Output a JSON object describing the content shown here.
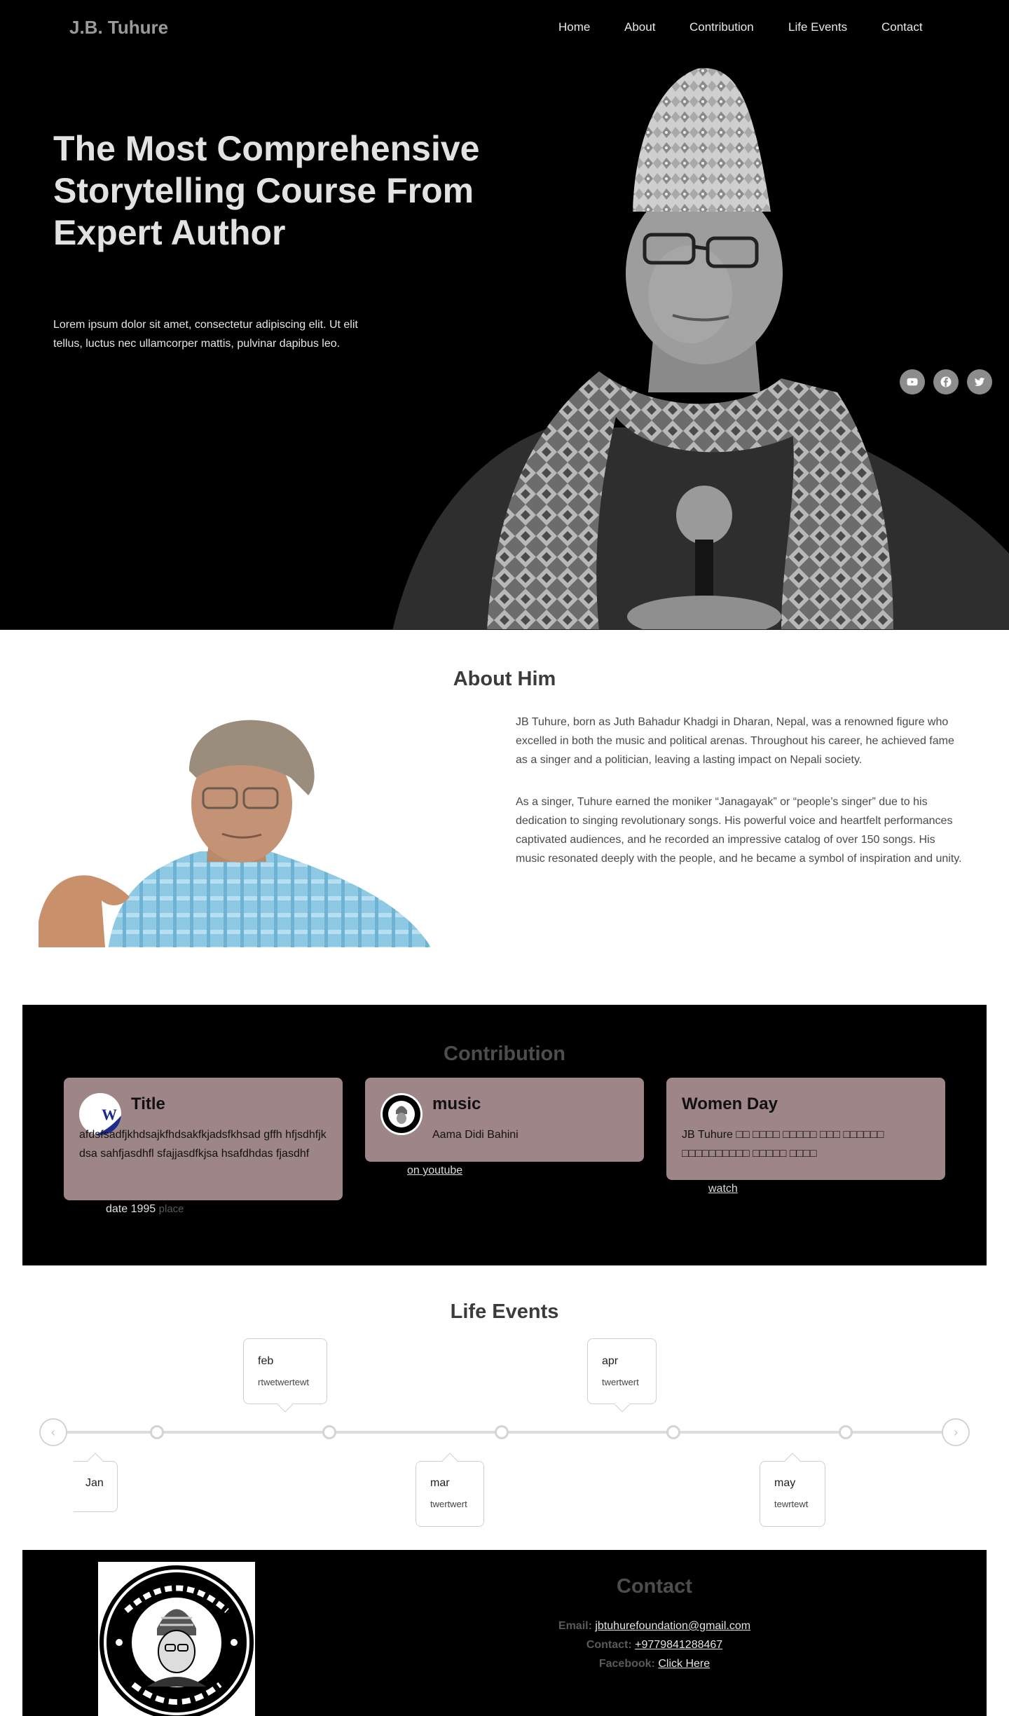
{
  "brand": "J.B. Tuhure",
  "nav": {
    "home": "Home",
    "about": "About",
    "contribution": "Contribution",
    "life_events": "Life Events",
    "contact": "Contact"
  },
  "hero": {
    "title": "The Most Comprehensive Storytelling Course From Expert Author",
    "subtitle": "Lorem ipsum dolor sit amet, consectetur adipiscing elit. Ut elit tellus, luctus nec ullamcorper mattis, pulvinar dapibus leo.",
    "social": [
      "youtube-icon",
      "facebook-icon",
      "twitter-icon"
    ]
  },
  "about": {
    "title": "About Him",
    "p1": "JB Tuhure, born as Juth Bahadur Khadgi in Dharan, Nepal, was a renowned figure who excelled in both the music and political arenas. Throughout his career, he achieved fame as a singer and a politician, leaving a lasting impact on Nepali society.",
    "p2": "As a singer, Tuhure earned the moniker “Janagayak” or “people’s singer” due to his dedication to singing revolutionary songs. His powerful voice and heartfelt performances captivated audiences, and he recorded an impressive catalog of over 150 songs. His music resonated deeply with the people, and he became a symbol of inspiration and unity."
  },
  "contribution": {
    "title": "Contribution",
    "cards": [
      {
        "title": "Title",
        "text": "afdsfsadfjkhdsajkfhdsakfkjadsfkhsad gffh hfjsdhfjkdsa sahfjasdhfl sfajjasdfkjsa hsafdhdas fjasdhf",
        "date": "date 1995",
        "place": "place"
      },
      {
        "title": "music",
        "text": "Aama Didi Bahini",
        "link": "on youtube"
      },
      {
        "title": "Women Day",
        "text": "JB Tuhure □□ □□□□ □□□□□ □□□ □□□□□□ □□□□□□□□□□ □□□□□ □□□□",
        "link": "watch"
      }
    ]
  },
  "life_events": {
    "title": "Life Events",
    "events": [
      {
        "month": "Jan",
        "text": ""
      },
      {
        "month": "feb",
        "text": "rtwetwertewt"
      },
      {
        "month": "mar",
        "text": "twertwert"
      },
      {
        "month": "apr",
        "text": "twertwert"
      },
      {
        "month": "may",
        "text": "tewrtewt"
      }
    ]
  },
  "contact": {
    "title": "Contact",
    "email_label": "Email:",
    "email": "jbtuhurefoundation@gmail.com",
    "phone_label": "Contact:",
    "phone": "+9779841288467",
    "facebook_label": "Facebook:",
    "facebook": "Click Here"
  },
  "colors": {
    "card_bg": "#9e8587",
    "section_bg": "#000000",
    "heading": "#3b3b3b"
  }
}
